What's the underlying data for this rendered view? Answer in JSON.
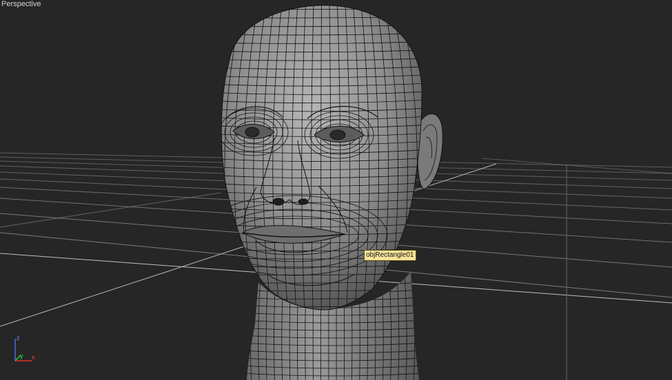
{
  "viewport": {
    "label": "Perspective",
    "background": "#262626",
    "grid_color": "#8c8c8c"
  },
  "selection_tooltip": "objRectangle01",
  "axis_gizmo": {
    "x": "x",
    "y": "y",
    "z": "z"
  },
  "model": {
    "wire_color": "#111111",
    "shade_color": "#8a8a8a"
  }
}
